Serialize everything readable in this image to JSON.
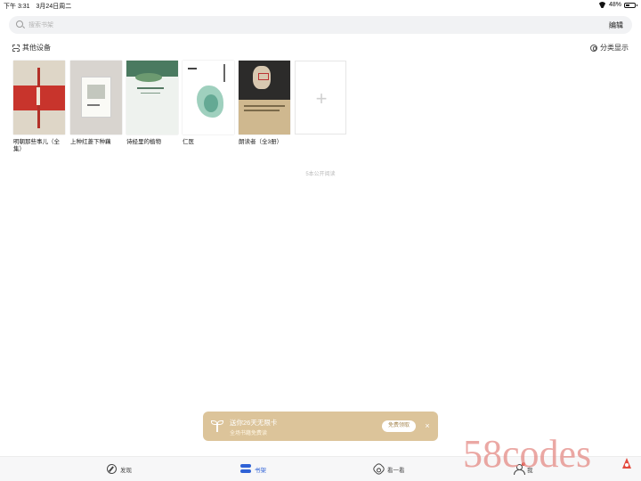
{
  "status_bar": {
    "time": "下午 3:31",
    "date": "3月24日周二",
    "battery_text": "48%",
    "battery_level": 0.48
  },
  "search": {
    "placeholder": "搜索书架",
    "edit_label": "编辑"
  },
  "toolbar": {
    "other_devices_label": "其他设备",
    "classify_label": "分类显示"
  },
  "books": [
    {
      "title": "明朝那些事儿（全集）",
      "cover_color": "#c8342c"
    },
    {
      "title": "上种红菱下种藕",
      "cover_color": "#d8d4cf"
    },
    {
      "title": "诗经里的植物",
      "cover_color": "#4a7a60"
    },
    {
      "title": "仁医",
      "cover_color": "#7fc0a8"
    },
    {
      "title": "朗读者（全3册）",
      "cover_color": "#cfb88f"
    }
  ],
  "add_book_symbol": "+",
  "shelf_count_text": "5本公开阅读",
  "promo": {
    "title": "送你26天无限卡",
    "subtitle": "全场书籍免费读",
    "button_label": "免费领取",
    "close_symbol": "×",
    "background_color": "#dcc49a"
  },
  "tabs": [
    {
      "label": "发现",
      "icon": "compass-icon",
      "active": false
    },
    {
      "label": "书架",
      "icon": "bookshelf-icon",
      "active": true
    },
    {
      "label": "看一看",
      "icon": "flower-icon",
      "active": false
    },
    {
      "label": "我",
      "icon": "user-icon",
      "active": false
    }
  ],
  "accent_color": "#2f62d6",
  "watermark_text": "58codes"
}
